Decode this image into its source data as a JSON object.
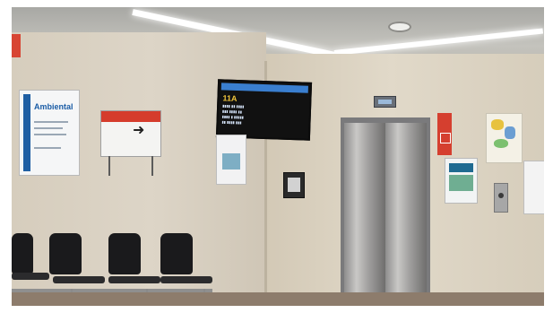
{
  "scene": {
    "poster_left": {
      "title": "Ambiental"
    },
    "tv_screen": {
      "big_code": "11A"
    },
    "colors": {
      "wall": "#d9d1c3",
      "ceiling": "#b9b6ae",
      "floor": "#8d7c6c",
      "sign_red": "#d53c2c",
      "tv_header_blue": "#3a7fd0"
    },
    "icons": {
      "direction_arrow": "right-arrow-icon"
    }
  }
}
